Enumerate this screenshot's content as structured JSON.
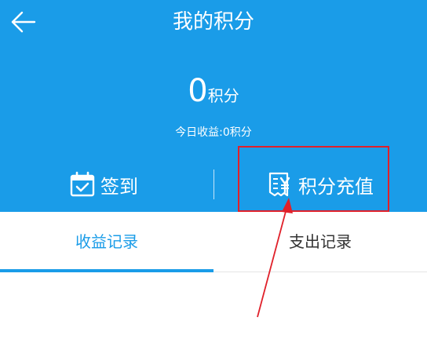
{
  "header": {
    "title": "我的积分",
    "back_icon": "arrow-left-icon"
  },
  "points": {
    "value": "0",
    "unit": "积分",
    "today_earnings": "今日收益:0积分"
  },
  "actions": {
    "checkin": {
      "label": "签到",
      "icon": "calendar-check-icon"
    },
    "recharge": {
      "label": "积分充值",
      "icon": "invoice-yen-icon"
    }
  },
  "tabs": [
    {
      "label": "收益记录",
      "active": true
    },
    {
      "label": "支出记录",
      "active": false
    }
  ],
  "colors": {
    "primary": "#1a9ce8",
    "annotation": "#e0202a",
    "tab_inactive_text": "#333333"
  }
}
